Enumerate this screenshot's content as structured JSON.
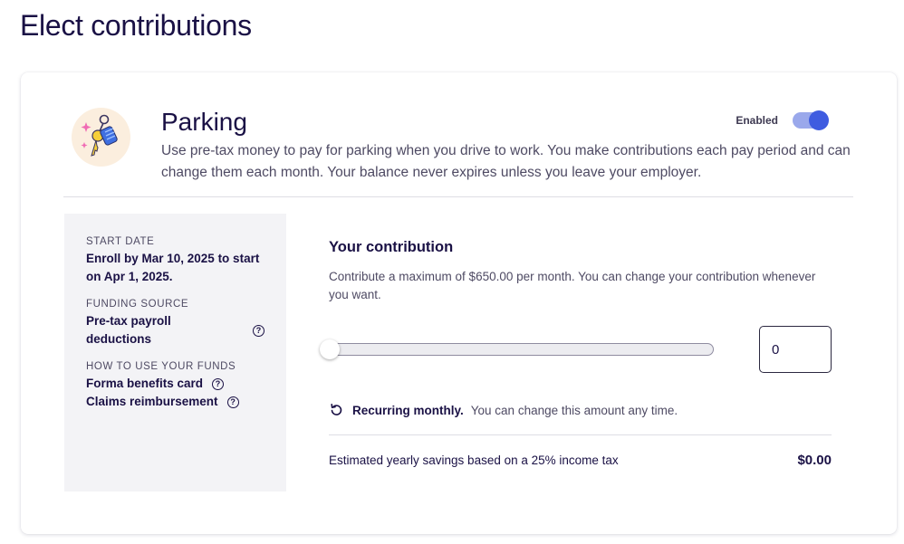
{
  "page": {
    "title": "Elect contributions"
  },
  "benefit": {
    "icon": "parking-key-icon",
    "title": "Parking",
    "description": "Use pre-tax money to pay for parking when you drive to work. You make contributions each pay period and can change them each month. Your balance never expires unless you leave your employer.",
    "toggle": {
      "label": "Enabled",
      "on": true
    }
  },
  "info": {
    "start_date": {
      "heading": "START DATE",
      "value": "Enroll by Mar 10, 2025 to start on Apr 1, 2025."
    },
    "funding_source": {
      "heading": "FUNDING SOURCE",
      "value": "Pre-tax payroll deductions"
    },
    "how_to_use": {
      "heading": "HOW TO USE YOUR FUNDS",
      "items": [
        "Forma benefits card",
        "Claims reimbursement"
      ]
    }
  },
  "contribution": {
    "title": "Your contribution",
    "description": "Contribute a maximum of $650.00 per month. You can change your contribution whenever you want.",
    "slider_value": 0,
    "slider_max": 650,
    "input_value": "0",
    "recurring_label": "Recurring monthly.",
    "recurring_note": "You can change this amount any time.",
    "savings_label": "Estimated yearly savings based on a 25% income tax",
    "savings_value": "$0.00"
  },
  "colors": {
    "accent": "#3f5ce0",
    "toggle_track": "#9aa8eb",
    "title": "#1a1145",
    "panel_bg": "#f3f3f6"
  }
}
